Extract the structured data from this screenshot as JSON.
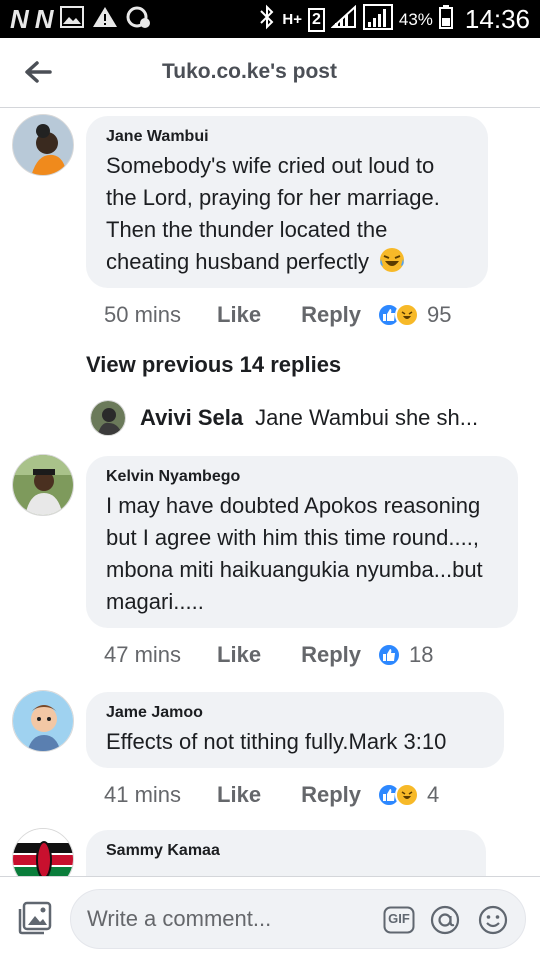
{
  "status_bar": {
    "carrier1": "N",
    "carrier2": "N",
    "network": "H+",
    "sim": "2",
    "battery": "43%",
    "time": "14:36"
  },
  "header": {
    "title": "Tuko.co.ke's post",
    "back_icon": "arrow-left-icon"
  },
  "comments": [
    {
      "author": "Jane Wambui",
      "text": "Somebody's wife cried out loud to the Lord, praying for her marriage. Then the thunder located the cheating husband perfectly",
      "emoji": "laughing-tears",
      "time": "50 mins",
      "like": "Like",
      "reply": "Reply",
      "reactions": [
        "like",
        "haha"
      ],
      "count": "95"
    },
    {
      "author": "Kelvin Nyambego",
      "text": "I may have doubted Apokos reasoning but I agree with him this time round...., mbona miti haikuangukia nyumba...but magari.....",
      "time": "47 mins",
      "like": "Like",
      "reply": "Reply",
      "reactions": [
        "like"
      ],
      "count": "18"
    },
    {
      "author": "Jame Jamoo",
      "text": "Effects of not tithing fully.Mark 3:10",
      "time": "41 mins",
      "like": "Like",
      "reply": "Reply",
      "reactions": [
        "like",
        "haha"
      ],
      "count": "4"
    },
    {
      "author": "Sammy Kamaa"
    }
  ],
  "view_previous": "View previous 14 replies",
  "reply_preview": {
    "author": "Avivi Sela",
    "text": "Jane Wambui she sh..."
  },
  "composer": {
    "placeholder": "Write a comment...",
    "gif_label": "GIF",
    "icons": [
      "photo-icon",
      "gif-icon",
      "mention-icon",
      "emoji-icon"
    ]
  },
  "colors": {
    "accent": "#2d88ff",
    "bubble": "#f0f2f5",
    "muted": "#65676b"
  }
}
